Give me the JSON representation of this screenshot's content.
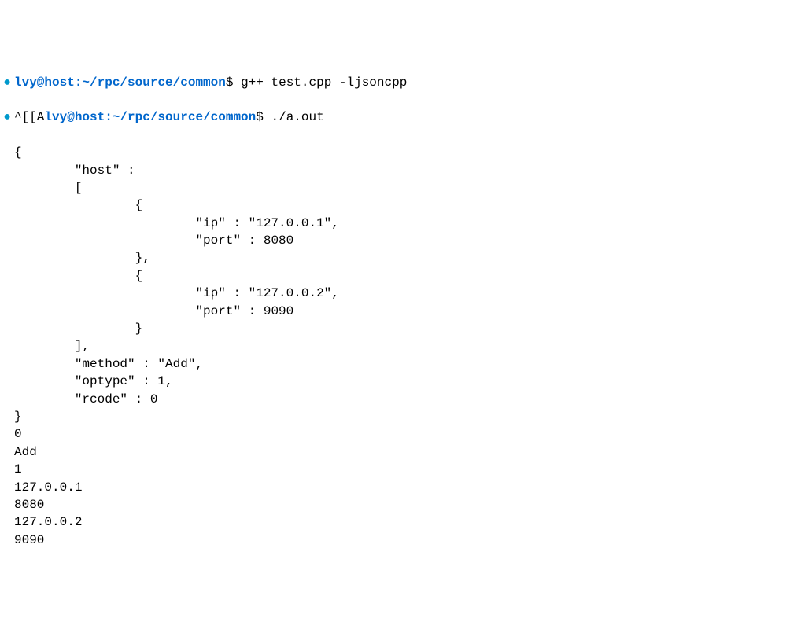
{
  "prompt1": {
    "userhost": "lvy@host",
    "path": "~/rpc/source/common",
    "dollar": "$",
    "command": "g++ test.cpp -ljsoncpp"
  },
  "prompt2": {
    "prefix": "^[[A",
    "userhost": "lvy@host",
    "path": "~/rpc/source/common",
    "dollar": "$",
    "command": "./a.out"
  },
  "output": {
    "lines": [
      "{",
      "        \"host\" :",
      "        [",
      "                {",
      "                        \"ip\" : \"127.0.0.1\",",
      "                        \"port\" : 8080",
      "                },",
      "                {",
      "                        \"ip\" : \"127.0.0.2\",",
      "                        \"port\" : 9090",
      "                }",
      "        ],",
      "        \"method\" : \"Add\",",
      "        \"optype\" : 1,",
      "        \"rcode\" : 0",
      "}",
      "0",
      "Add",
      "1",
      "127.0.0.1",
      "8080",
      "127.0.0.2",
      "9090"
    ]
  }
}
